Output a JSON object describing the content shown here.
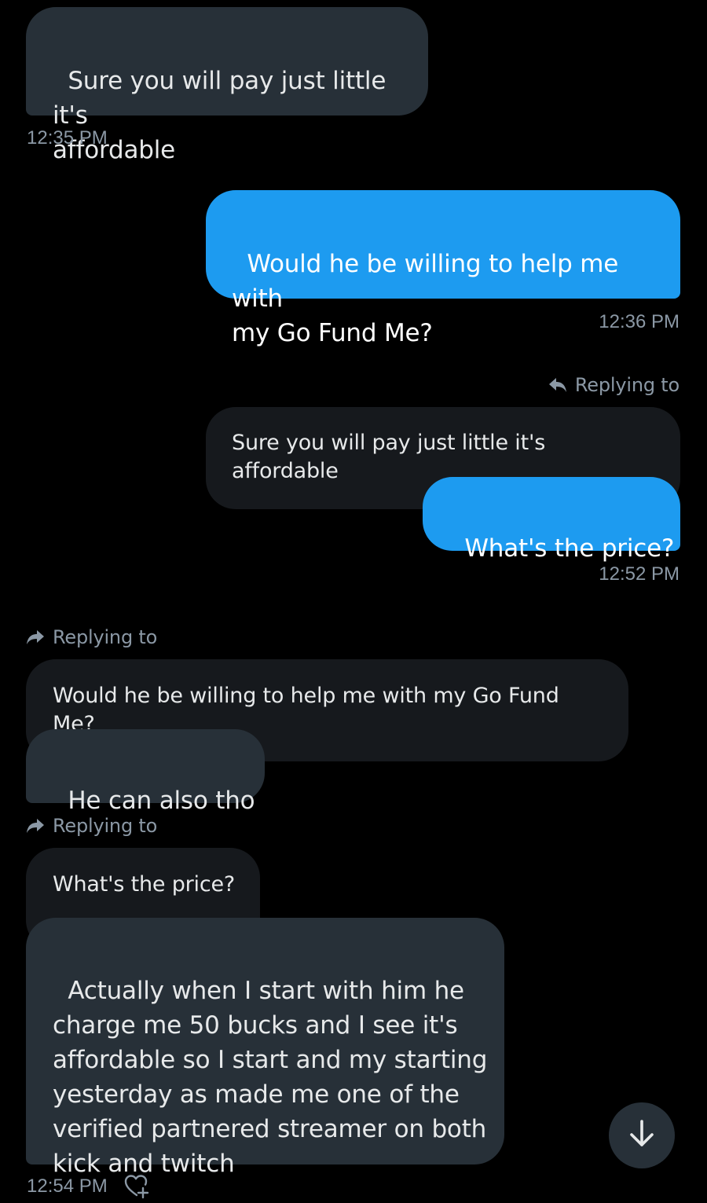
{
  "messages": {
    "m1": {
      "text": "Sure you will pay just little it's\naffordable",
      "time": "12:35 PM"
    },
    "m2": {
      "text": "Would he be willing to help me with\nmy Go Fund Me?",
      "time": "12:36 PM"
    },
    "m3": {
      "replying_label": "Replying to",
      "quoted": "Sure you will pay just little it's affordable",
      "text": "What's the price?",
      "time": "12:52 PM"
    },
    "m4": {
      "replying_label": "Replying to",
      "quoted": "Would he be willing to help me with my Go Fund Me?",
      "text": "He can also tho"
    },
    "m5": {
      "replying_label": "Replying to",
      "quoted": "What's the price?",
      "text": "Actually when I start with him he\ncharge me 50 bucks and I see it's\naffordable so I start and my starting\nyesterday as made me one of the\nverified partnered streamer on both\nkick and twitch",
      "time": "12:54 PM"
    }
  },
  "colors": {
    "background": "#000000",
    "incoming_bubble": "#273038",
    "outgoing_bubble": "#1d9bf0",
    "quoted_bubble": "#16191d",
    "secondary_text": "#8b98a5"
  },
  "icons": {
    "reply_outgoing": "reply-arrow-icon",
    "reply_incoming": "forward-arrow-icon",
    "react": "heart-plus-icon",
    "scroll_down": "arrow-down-icon"
  }
}
